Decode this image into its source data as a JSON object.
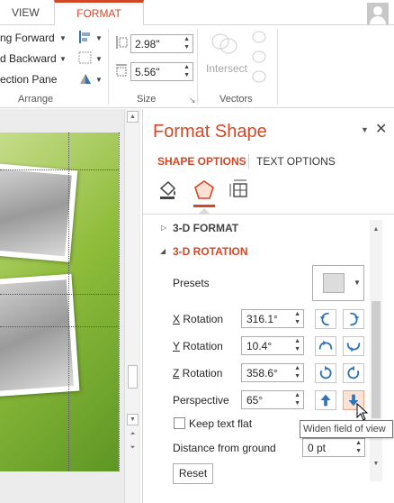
{
  "tabs": {
    "view": "VIEW",
    "format": "FORMAT"
  },
  "ribbon": {
    "arrange": {
      "bring_forward": "ng Forward",
      "send_backward": "d Backward",
      "selection_pane": "ection Pane",
      "label": "Arrange"
    },
    "size": {
      "height": "2.98\"",
      "width": "5.56\"",
      "label": "Size"
    },
    "vectors": {
      "intersect": "Intersect",
      "label": "Vectors"
    }
  },
  "pane": {
    "title": "Format Shape",
    "tabs": {
      "shape_options": "SHAPE OPTIONS",
      "text_options": "TEXT OPTIONS"
    },
    "sections": {
      "format_3d": "3-D FORMAT",
      "rotation_3d": "3-D ROTATION"
    },
    "rotation": {
      "presets": {
        "label": "Presets"
      },
      "x": {
        "label_key": "X",
        "label_rest": " Rotation",
        "value": "316.1°"
      },
      "y": {
        "label_key": "Y",
        "label_rest": " Rotation",
        "value": "10.4°"
      },
      "z": {
        "label_key": "Z",
        "label_rest": " Rotation",
        "value": "358.6°"
      },
      "perspective": {
        "label": "Perspective",
        "value": "65°"
      },
      "keep_text_flat": {
        "label": "Keep text flat",
        "checked": false
      },
      "distance": {
        "label": "Distance from ground",
        "value": "0 pt"
      },
      "reset": "Reset"
    },
    "tooltip": "Widen field of view"
  },
  "colors": {
    "accent": "#d24726",
    "icon_blue": "#2e75b6",
    "slide_green": "#8fbd3b"
  }
}
